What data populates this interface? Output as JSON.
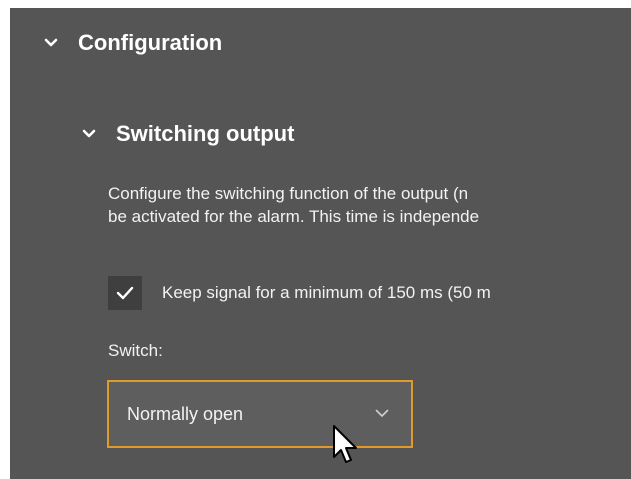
{
  "configuration": {
    "title": "Configuration",
    "expand_icon": "chevron-down-icon"
  },
  "switching_output": {
    "title": "Switching output",
    "expand_icon": "chevron-down-icon",
    "description_line1": "Configure the switching function of the output (n",
    "description_line2": "be activated for the alarm. This time is independe",
    "keep_signal": {
      "checked": true,
      "label": "Keep signal for a minimum of 150 ms (50 m"
    },
    "switch": {
      "label": "Switch:",
      "selected": "Normally open",
      "dropdown_icon": "chevron-down-icon"
    }
  },
  "colors": {
    "panel_background": "#555555",
    "focus_border": "#e09a2c",
    "checkbox_background": "#3f3f3f"
  }
}
